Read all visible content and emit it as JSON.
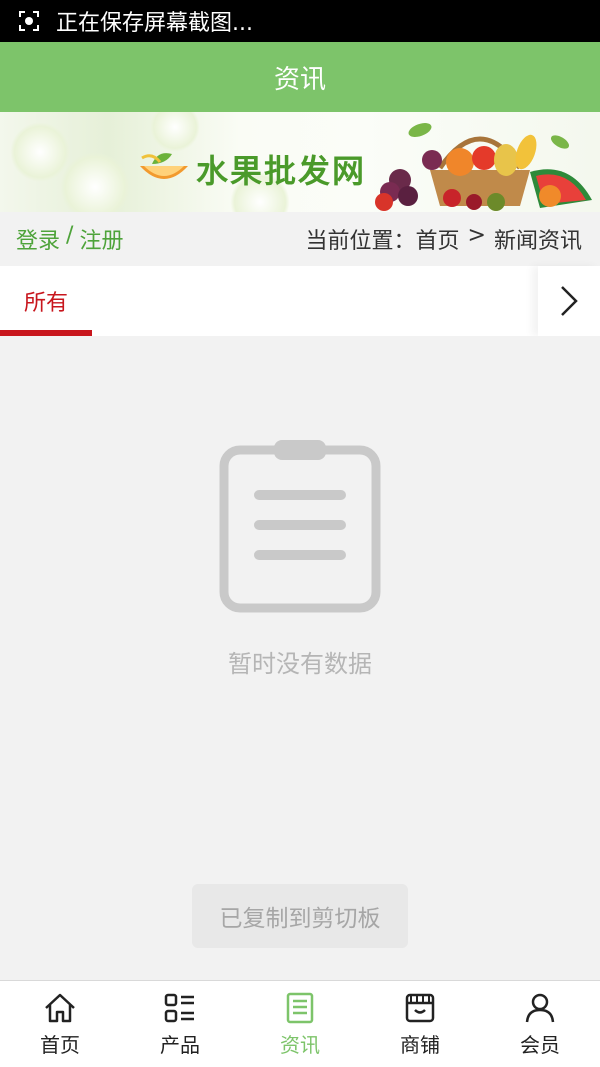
{
  "status_bar": {
    "text": "正在保存屏幕截图..."
  },
  "header": {
    "title": "资讯"
  },
  "banner": {
    "brand": "水果批发网"
  },
  "location": {
    "login_label": "登录",
    "separator": "/",
    "register_label": "注册",
    "prefix": "当前位置：",
    "home": "首页",
    "arrow": ">",
    "current": "新闻资讯"
  },
  "tabs": {
    "active_label": "所有"
  },
  "empty_state": {
    "message": "暂时没有数据"
  },
  "toast": {
    "text": "已复制到剪切板"
  },
  "bottom_nav": {
    "items": [
      {
        "label": "首页",
        "icon": "home-icon"
      },
      {
        "label": "产品",
        "icon": "grid-list-icon"
      },
      {
        "label": "资讯",
        "icon": "news-icon",
        "active": true
      },
      {
        "label": "商铺",
        "icon": "shop-icon"
      },
      {
        "label": "会员",
        "icon": "user-icon"
      }
    ]
  },
  "colors": {
    "accent": "#7dc46a",
    "tab_active": "#c8161d",
    "link": "#4ea33a"
  }
}
